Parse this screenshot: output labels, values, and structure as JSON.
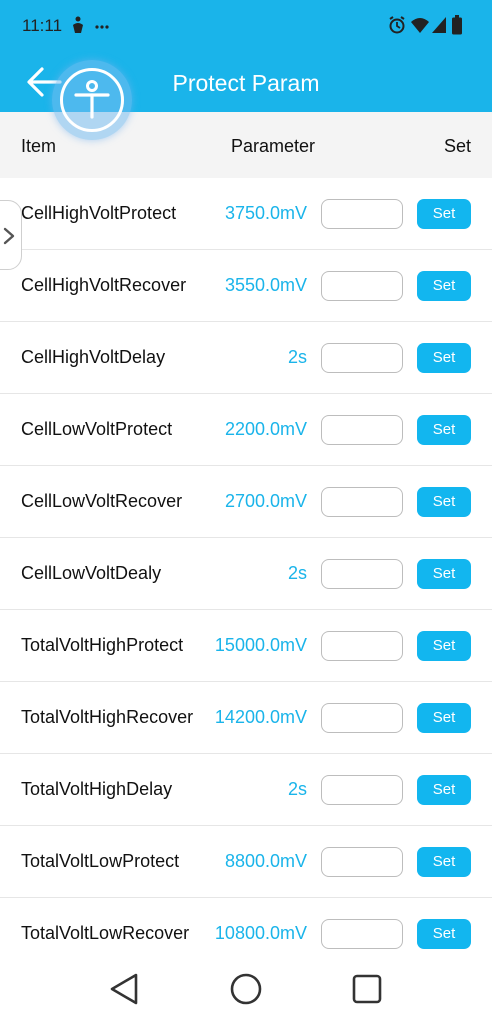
{
  "status_bar": {
    "time": "11:11"
  },
  "app_bar": {
    "title": "Protect Param"
  },
  "table_header": {
    "item": "Item",
    "parameter": "Parameter",
    "set": "Set"
  },
  "rows": [
    {
      "name": "CellHighVoltProtect",
      "value": "3750.0mV",
      "input": "",
      "button": "Set"
    },
    {
      "name": "CellHighVoltRecover",
      "value": "3550.0mV",
      "input": "",
      "button": "Set"
    },
    {
      "name": "CellHighVoltDelay",
      "value": "2s",
      "input": "",
      "button": "Set"
    },
    {
      "name": "CellLowVoltProtect",
      "value": "2200.0mV",
      "input": "",
      "button": "Set"
    },
    {
      "name": "CellLowVoltRecover",
      "value": "2700.0mV",
      "input": "",
      "button": "Set"
    },
    {
      "name": "CellLowVoltDealy",
      "value": "2s",
      "input": "",
      "button": "Set"
    },
    {
      "name": "TotalVoltHighProtect",
      "value": "15000.0mV",
      "input": "",
      "button": "Set"
    },
    {
      "name": "TotalVoltHighRecover",
      "value": "14200.0mV",
      "input": "",
      "button": "Set"
    },
    {
      "name": "TotalVoltHighDelay",
      "value": "2s",
      "input": "",
      "button": "Set"
    },
    {
      "name": "TotalVoltLowProtect",
      "value": "8800.0mV",
      "input": "",
      "button": "Set"
    },
    {
      "name": "TotalVoltLowRecover",
      "value": "10800.0mV",
      "input": "",
      "button": "Set"
    }
  ],
  "icons": {
    "status": [
      "signal-app-icon",
      "more-dots-icon",
      "alarm-icon",
      "wifi-icon",
      "cell-signal-icon",
      "battery-icon"
    ],
    "app": [
      "back-arrow-icon",
      "accessibility-float-icon",
      "chevron-right-icon"
    ],
    "nav": [
      "nav-back-icon",
      "nav-home-icon",
      "nav-recents-icon"
    ]
  },
  "colors": {
    "accent": "#1ab4ea",
    "button": "#12b6ef",
    "header_bg": "#f4f4f4",
    "value_text": "#1ab4ea"
  }
}
